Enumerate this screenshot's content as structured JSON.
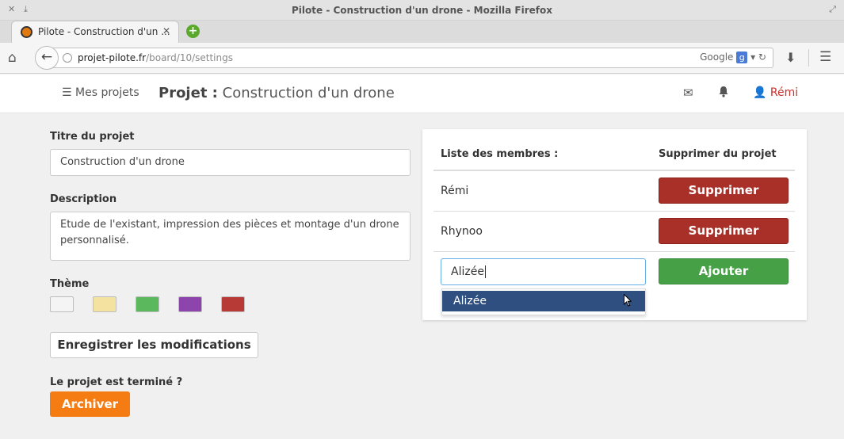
{
  "window": {
    "title": "Pilote - Construction d'un drone - Mozilla Firefox"
  },
  "browser": {
    "tab_title": "Pilote - Construction d'un ...",
    "url_host": "projet-pilote.fr",
    "url_path": "/board/10/settings",
    "search_engine": "Google"
  },
  "header": {
    "my_projects": "Mes projets",
    "project_label": "Projet :",
    "project_name": "Construction d'un drone",
    "user": "Rémi"
  },
  "form": {
    "title_label": "Titre du projet",
    "title_value": "Construction d'un drone",
    "description_label": "Description",
    "description_value": "Etude de l'existant, impression des pièces et montage d'un drone personnalisé.",
    "theme_label": "Thème",
    "themes": [
      "#f4f4f4",
      "#f4e2a0",
      "#5cb85c",
      "#8e44ad",
      "#b83a36"
    ],
    "save_label": "Enregistrer les modifications",
    "done_label": "Le projet est terminé ?",
    "archive_label": "Archiver"
  },
  "members": {
    "header_list": "Liste des membres :",
    "header_remove": "Supprimer du projet",
    "list": [
      {
        "name": "Rémi",
        "action": "Supprimer"
      },
      {
        "name": "Rhynoo",
        "action": "Supprimer"
      }
    ],
    "input_value": "Alizée",
    "suggestion": "Alizée",
    "add_label": "Ajouter"
  },
  "colors": {
    "danger": "#a93028",
    "success": "#46a146",
    "warning": "#f57c13",
    "highlight": "#2f4f80"
  }
}
